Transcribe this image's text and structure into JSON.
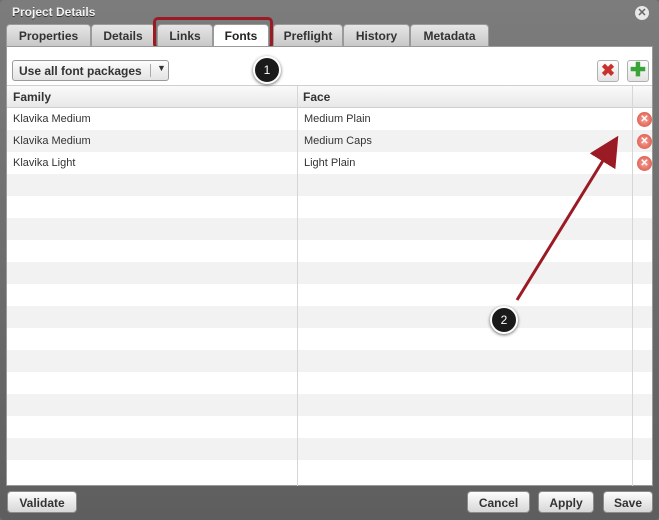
{
  "window": {
    "title": "Project Details"
  },
  "tabs": [
    {
      "label": "Properties"
    },
    {
      "label": "Details"
    },
    {
      "label": "Links"
    },
    {
      "label": "Fonts"
    },
    {
      "label": "Preflight"
    },
    {
      "label": "History"
    },
    {
      "label": "Metadata"
    }
  ],
  "active_tab": "Fonts",
  "toolbar": {
    "package_filter": "Use all font packages",
    "delete_icon": "red-x-icon",
    "add_icon": "green-plus-icon"
  },
  "table": {
    "columns": [
      "Family",
      "Face"
    ],
    "rows": [
      {
        "family": "Klavika Medium",
        "face": "Medium Plain"
      },
      {
        "family": "Klavika Medium",
        "face": "Medium Caps"
      },
      {
        "family": "Klavika Light",
        "face": "Light Plain"
      }
    ]
  },
  "callouts": [
    "1",
    "2"
  ],
  "footer": {
    "validate": "Validate",
    "cancel": "Cancel",
    "apply": "Apply",
    "save": "Save"
  },
  "colors": {
    "annotation": "#9b1b24"
  }
}
